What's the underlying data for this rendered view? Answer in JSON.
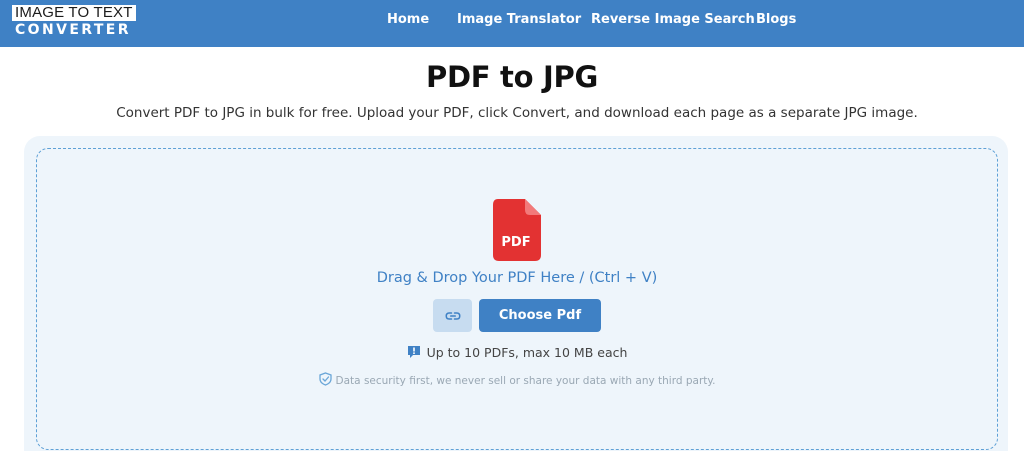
{
  "header": {
    "logo_top": "IMAGE TO TEXT",
    "logo_bottom": "CONVERTER",
    "nav": [
      {
        "label": "Home"
      },
      {
        "label": "Image Translator"
      },
      {
        "label": "Reverse Image Search"
      },
      {
        "label": "Blogs"
      }
    ]
  },
  "main": {
    "title": "PDF to JPG",
    "subtitle": "Convert PDF to JPG in bulk for free. Upload your PDF, click Convert, and download each page as a separate JPG image."
  },
  "upload": {
    "file_icon_label": "PDF",
    "drop_text": "Drag & Drop Your PDF Here / (Ctrl + V)",
    "link_button_icon": "link-icon",
    "choose_button_label": "Choose Pdf",
    "limit_text": "Up to 10 PDFs, max 10 MB each",
    "security_text": "Data security first, we never sell or share your data with any third party."
  },
  "colors": {
    "header_bg": "#3f81c5",
    "accent": "#3f81c5",
    "pdf_red": "#e33232",
    "upload_bg": "#eef5fb",
    "link_btn_bg": "#c7dcf0"
  }
}
